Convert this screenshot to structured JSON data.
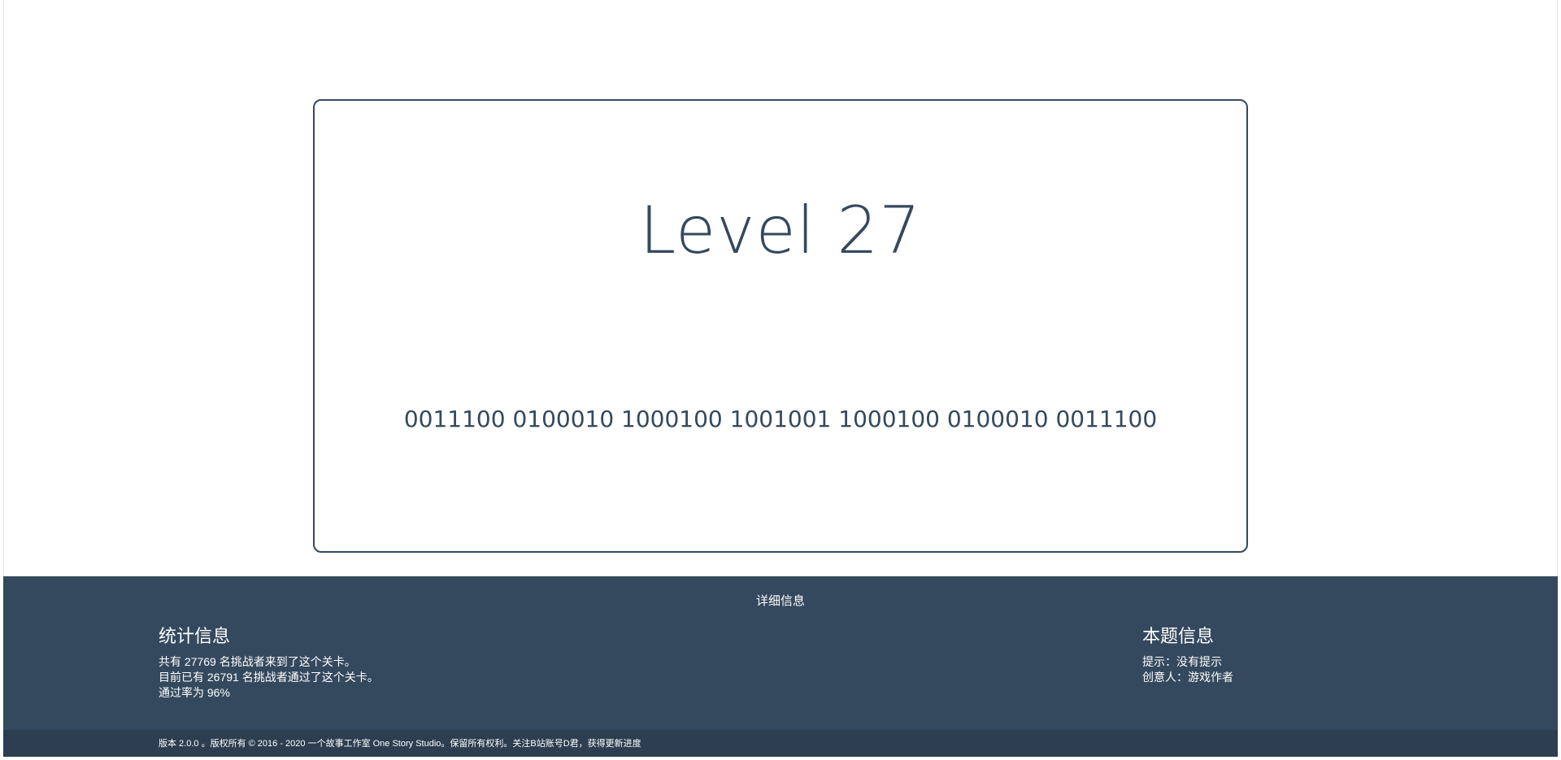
{
  "level": {
    "title": "Level 27",
    "code": "0011100 0100010 1000100 1001001 1000100 0100010 0011100"
  },
  "footer": {
    "heading": "详细信息",
    "stats": {
      "title": "统计信息",
      "line1": "共有 27769 名挑战者来到了这个关卡。",
      "line2": "目前已有 26791 名挑战者通过了这个关卡。",
      "line3": "通过率为 96%"
    },
    "info": {
      "title": "本题信息",
      "hint": "提示：没有提示",
      "creator": "创意人：游戏作者"
    },
    "copyright": "版本 2.0.0 。版权所有 © 2016 - 2020 一个故事工作室 One Story Studio。保留所有权利。关注B站账号D君，获得更新进度"
  },
  "colors": {
    "primary": "#34495e",
    "footer_bottom": "#2c3e50",
    "background": "#ffffff"
  }
}
